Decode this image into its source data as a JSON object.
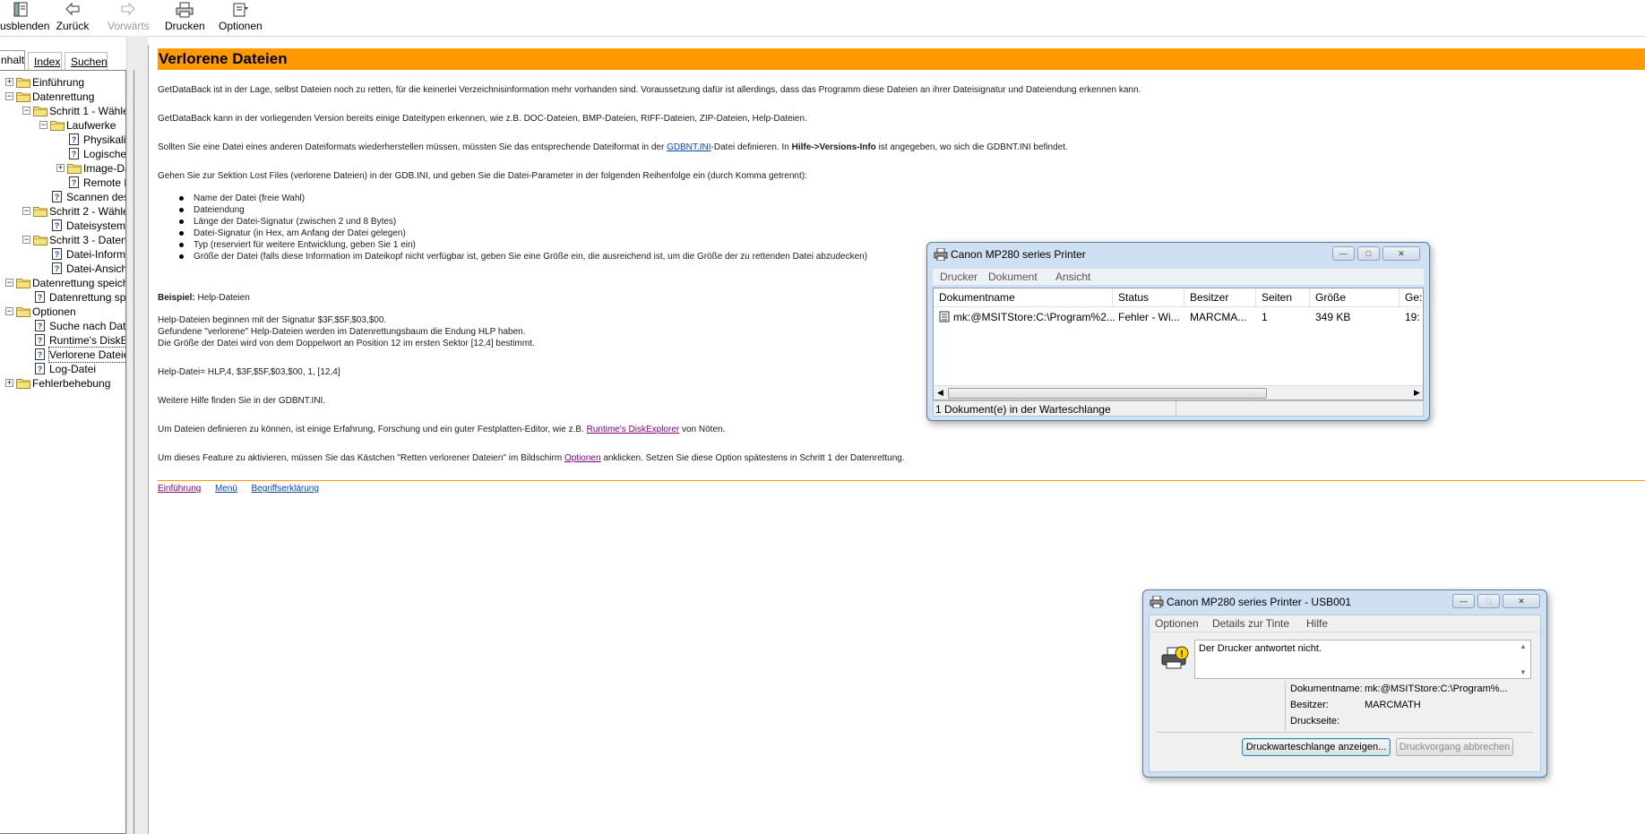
{
  "toolbar": {
    "hide_label": "usblenden",
    "back_label": "Zurück",
    "forward_label": "Vorwärts",
    "print_label": "Drucken",
    "options_label": "Optionen"
  },
  "nav_tabs": [
    "nhalt",
    "Index",
    "Suchen"
  ],
  "tree": [
    {
      "label": "Einführung",
      "level": 0,
      "type": "folder",
      "exp": "+"
    },
    {
      "label": "Datenrettung",
      "level": 0,
      "type": "folder",
      "exp": "-"
    },
    {
      "label": "Schritt 1 - Wähle",
      "level": 1,
      "type": "folder",
      "exp": "-"
    },
    {
      "label": "Laufwerke",
      "level": 2,
      "type": "folder",
      "exp": "-"
    },
    {
      "label": "Physikali",
      "level": 3,
      "type": "page"
    },
    {
      "label": "Logische",
      "level": 3,
      "type": "page"
    },
    {
      "label": "Image-Da",
      "level": 3,
      "type": "folder",
      "exp": "+"
    },
    {
      "label": "Remote L",
      "level": 3,
      "type": "page"
    },
    {
      "label": "Scannen des",
      "level": 2,
      "type": "page"
    },
    {
      "label": "Schritt 2 - Wähle",
      "level": 1,
      "type": "folder",
      "exp": "-"
    },
    {
      "label": "Dateisystems",
      "level": 2,
      "type": "page"
    },
    {
      "label": "Schritt 3 - Datenr",
      "level": 1,
      "type": "folder",
      "exp": "-"
    },
    {
      "label": "Datei-Informa",
      "level": 2,
      "type": "page"
    },
    {
      "label": "Datei-Ansicht",
      "level": 2,
      "type": "page"
    },
    {
      "label": "Datenrettung speiche",
      "level": 0,
      "type": "folder",
      "exp": "-"
    },
    {
      "label": "Datenrettung spe",
      "level": 1,
      "type": "page"
    },
    {
      "label": "Optionen",
      "level": 0,
      "type": "folder",
      "exp": "-"
    },
    {
      "label": "Suche nach Date",
      "level": 1,
      "type": "page"
    },
    {
      "label": "Runtime's DiskEx",
      "level": 1,
      "type": "page"
    },
    {
      "label": "Verlorene Dateien",
      "level": 1,
      "type": "page",
      "selected": true
    },
    {
      "label": "Log-Datei",
      "level": 1,
      "type": "page"
    },
    {
      "label": "Fehlerbehebung",
      "level": 0,
      "type": "folder",
      "exp": "+"
    }
  ],
  "content": {
    "title": "Verlorene Dateien",
    "p1": "GetDataBack ist in der Lage, selbst Dateien noch zu retten, für die keinerlei Verzeichnisinformation mehr vorhanden sind. Voraussetzung dafür ist allerdings, dass das Programm diese Dateien an ihrer Dateisignatur und Dateiendung erkennen kann.",
    "p2": "GetDataBack kann in der vorliegenden Version bereits einige Dateitypen erkennen, wie z.B. DOC-Dateien, BMP-Dateien, RIFF-Dateien, ZIP-Dateien, Help-Dateien.",
    "p3a": "Sollten Sie eine Datei eines anderen Dateiformats wiederherstellen müssen, müssten Sie das entsprechende Dateiformat in der ",
    "p3link": "GDBNT.INI",
    "p3b": "-Datei definieren. In ",
    "p3bold": "Hilfe->Versions-Info",
    "p3c": " ist angegeben, wo sich die GDBNT.INI befindet.",
    "p4": "Gehen Sie zur Sektion Lost Files (verlorene Dateien) in der GDB.INI, und geben Sie die Datei-Parameter in der folgenden Reihenfolge ein (durch Komma getrennt):",
    "bullets": [
      "Name der Datei (freie Wahl)",
      "Dateiendung",
      "Länge der Datei-Signatur (zwischen 2 und 8 Bytes)",
      "Datei-Signatur (in Hex, am Anfang der Datei gelegen)",
      "Typ (reserviert für weitere Entwicklung, geben Sie 1 ein)",
      "Größe der Datei (falls diese Information im Dateikopf nicht verfügbar ist, geben Sie eine Größe ein, die ausreichend ist, um die Größe der zu rettenden Datei abzudecken)"
    ],
    "example_bold": "Beispiel:",
    "example_text": " Help-Dateien",
    "ex1": "Help-Dateien beginnen mit der Signatur $3F,$5F,$03,$00.",
    "ex2": "Gefundene \"verlorene\" Help-Dateien werden im Datenrettungsbaum die Endung HLP haben.",
    "ex3": "Die Größe der Datei wird von dem Doppelwort an Position 12 im ersten Sektor [12,4] bestimmt.",
    "ex4": "Help-Datei= HLP,4, $3F,$5F,$03,$00, 1, [12,4]",
    "p5": "Weitere Hilfe finden Sie in der GDBNT.INI.",
    "p6a": "Um Dateien definieren zu können, ist einige Erfahrung, Forschung und ein guter Festplatten-Editor, wie z.B. ",
    "p6link": "Runtime's DiskExplorer",
    "p6b": " von Nöten.",
    "p7a": "Um dieses Feature zu aktivieren, müssen Sie das Kästchen \"Retten verlorener Dateien\" im Bildschirm ",
    "p7link": "Optionen",
    "p7b": " anklicken. Setzen Sie diese Option spätestens in Schritt 1 der Datenrettung.",
    "footer_links": [
      "Einführung",
      "Menü",
      "Begriffserklärung"
    ]
  },
  "queue_window": {
    "title": "Canon MP280 series Printer",
    "menu": [
      "Drucker",
      "Dokument",
      "Ansicht"
    ],
    "columns": [
      "Dokumentname",
      "Status",
      "Besitzer",
      "Seiten",
      "Größe",
      "Ge:"
    ],
    "row": {
      "name": "mk:@MSITStore:C:\\Program%2...",
      "status": "Fehler - Wi...",
      "owner": "MARCMA...",
      "pages": "1",
      "size": "349 KB",
      "time": "19:"
    },
    "status_text": "1 Dokument(e) in der Warteschlange"
  },
  "alert_window": {
    "title": "Canon MP280 series Printer - USB001",
    "menu": [
      "Optionen",
      "Details zur Tinte",
      "Hilfe"
    ],
    "message": "Der Drucker antwortet nicht.",
    "doc_label": "Dokumentname:",
    "doc_value": "mk:@MSITStore:C:\\Program%...",
    "owner_label": "Besitzer:",
    "owner_value": "MARCMATH",
    "page_label": "Druckseite:",
    "btn_show": "Druckwarteschlange anzeigen...",
    "btn_cancel": "Druckvorgang abbrechen"
  }
}
